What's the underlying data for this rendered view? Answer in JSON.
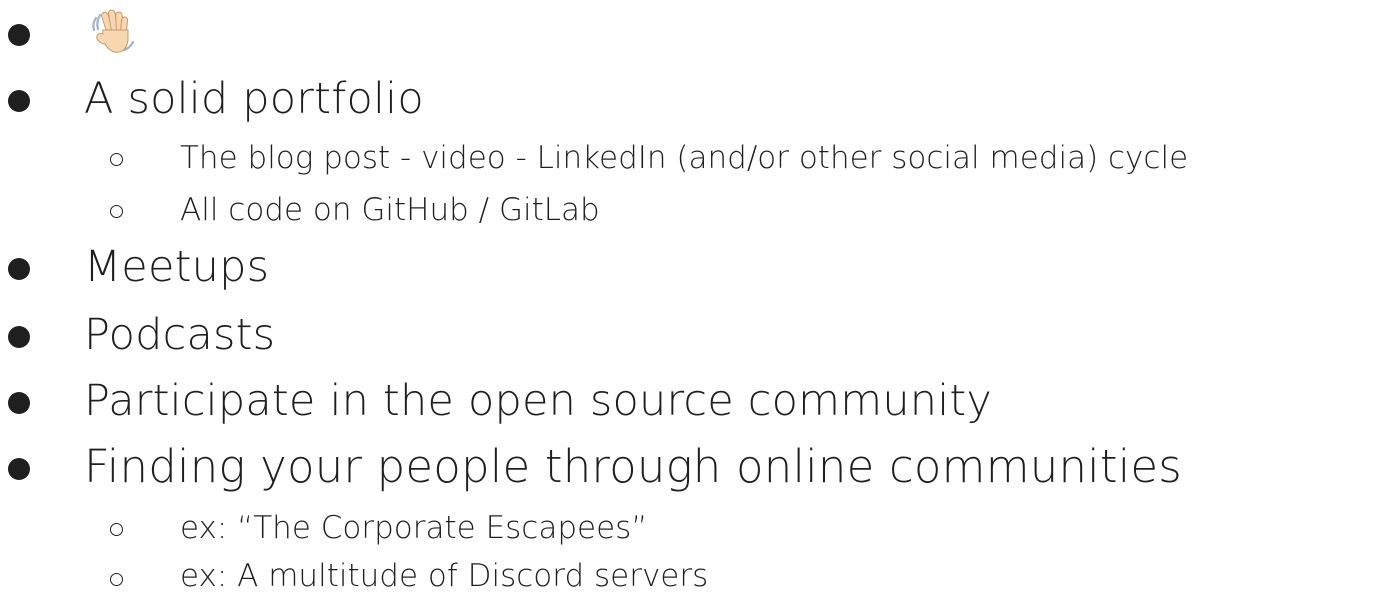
{
  "list": {
    "item_0": {
      "icon": "waving-hand-icon"
    },
    "item_1": {
      "text": "A solid portfolio",
      "sub_0": "The blog post - video - LinkedIn (and/or other social media) cycle",
      "sub_1": "All code on GitHub / GitLab"
    },
    "item_2": {
      "text": "Meetups"
    },
    "item_3": {
      "text": "Podcasts"
    },
    "item_4": {
      "text": "Participate in the open source community"
    },
    "item_5": {
      "text": "Finding your people through online communities",
      "sub_0": "ex: “The Corporate Escapees”",
      "sub_1": "ex: A multitude of Discord servers"
    }
  },
  "colors": {
    "text": "#1f1f1f",
    "background": "#ffffff",
    "wave_skin": "#f7d6b0"
  }
}
